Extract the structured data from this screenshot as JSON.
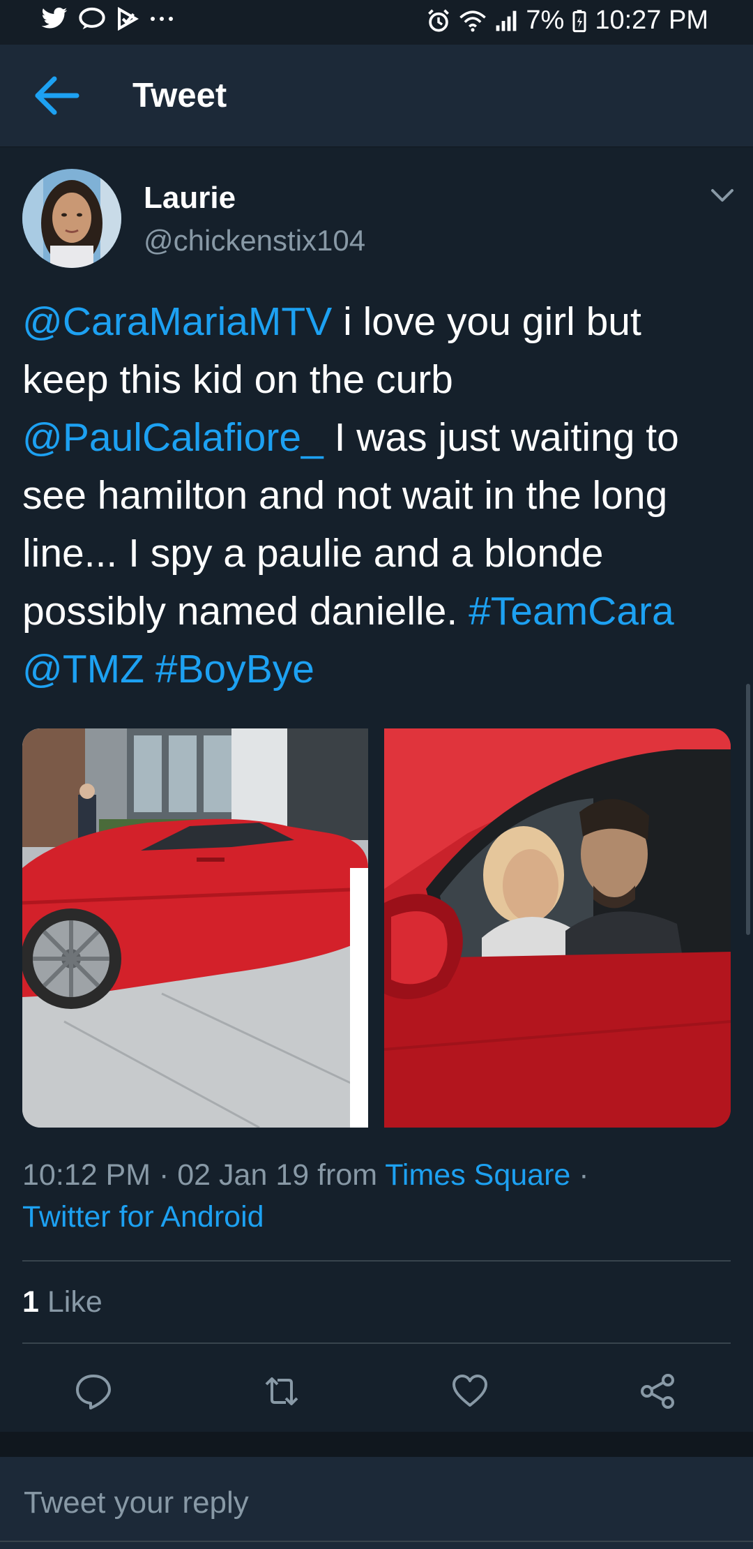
{
  "status_bar": {
    "battery": "7%",
    "time": "10:27 PM",
    "left_icons": [
      "twitter-icon",
      "messenger-icon",
      "check-icon",
      "more-icon"
    ],
    "right_icons": [
      "alarm-icon",
      "wifi-icon",
      "signal-icon",
      "battery-icon"
    ]
  },
  "header": {
    "title": "Tweet"
  },
  "author": {
    "name": "Laurie",
    "handle": "@chickenstix104"
  },
  "tweet": {
    "mention1": "@CaraMariaMTV",
    "text1": "  i love you girl but keep this kid on the curb ",
    "mention2": "@PaulCalafiore_",
    "text2": " I was just waiting to see hamilton and not wait in the long line... I spy a paulie and a blonde possibly named danielle. ",
    "hashtag1": "#TeamCara",
    "mention3": "@TMZ",
    "hashtag2": "#BoyBye"
  },
  "meta": {
    "timestamp": "10:12 PM · 02 Jan 19 from ",
    "location": "Times Square",
    "separator": " ·",
    "source": "Twitter for Android"
  },
  "stats": {
    "like_count": "1",
    "like_label": "Like"
  },
  "actions": [
    "reply-icon",
    "retweet-icon",
    "like-icon",
    "share-icon"
  ],
  "reply": {
    "placeholder": "Tweet your reply"
  },
  "colors": {
    "background": "#15202b",
    "header": "#1c2938",
    "accent": "#1da1f2",
    "secondary_text": "#8899a6",
    "divider": "#38444d"
  }
}
